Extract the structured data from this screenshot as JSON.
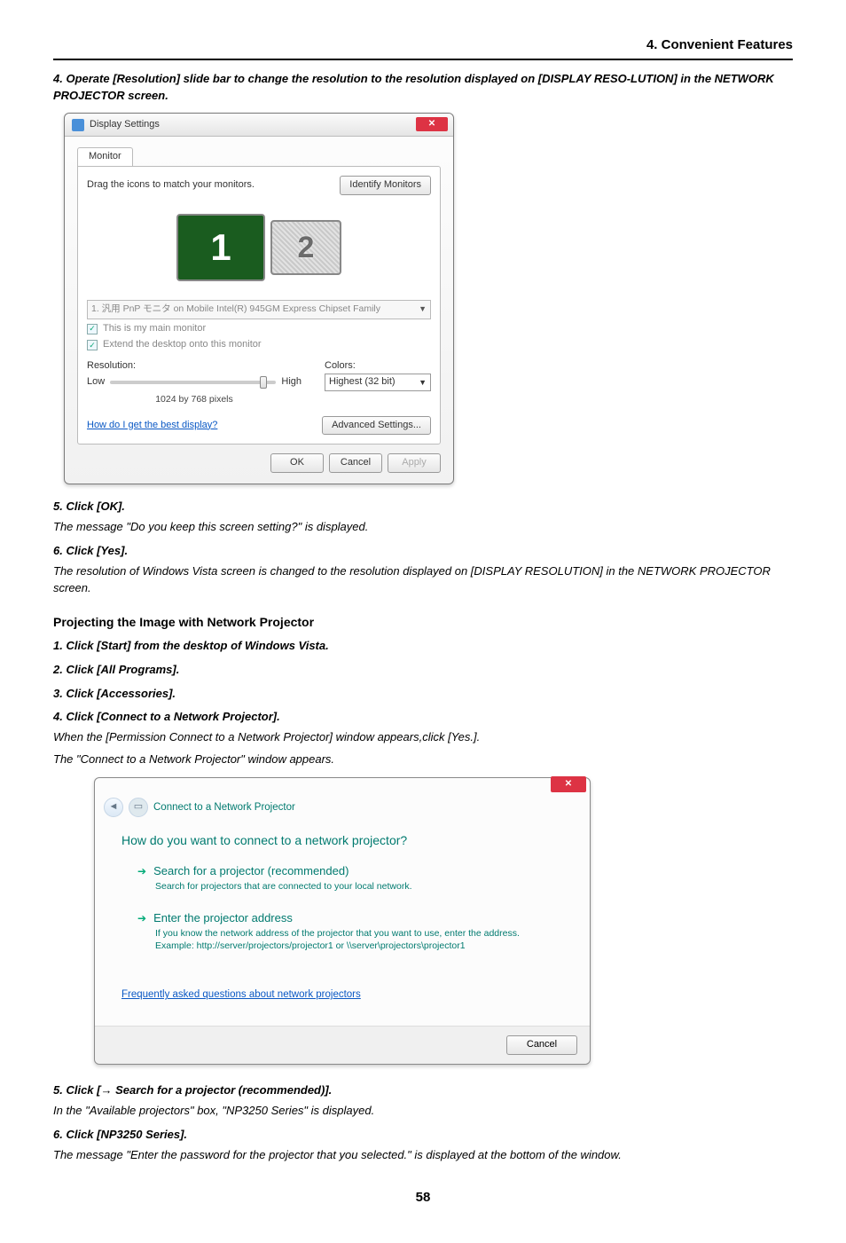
{
  "header": {
    "title": "4. Convenient Features"
  },
  "steps_upper": [
    {
      "num": "4.",
      "text": "Operate [Resolution] slide bar to change the resolution to the resolution displayed on [DISPLAY RESO-LUTION] in the NETWORK PROJECTOR screen."
    }
  ],
  "dlg1": {
    "title": "Display Settings",
    "tab": "Monitor",
    "drag": "Drag the icons to match your monitors.",
    "identify": "Identify Monitors",
    "mon1": "1",
    "mon2": "2",
    "combo": "1. 汎用 PnP モニタ on Mobile Intel(R) 945GM Express Chipset Family",
    "chk1": "This is my main monitor",
    "chk2": "Extend the desktop onto this monitor",
    "res_label": "Resolution:",
    "low": "Low",
    "high": "High",
    "res_val": "1024 by 768 pixels",
    "colors_label": "Colors:",
    "colors_val": "Highest (32 bit)",
    "best": "How do I get the best display?",
    "adv": "Advanced Settings...",
    "ok": "OK",
    "cancel": "Cancel",
    "apply": "Apply"
  },
  "steps_mid": [
    {
      "num": "5.",
      "bold": "Click [OK].",
      "body": "The message \"Do you keep this screen setting?\" is displayed."
    },
    {
      "num": "6.",
      "bold": "Click [Yes].",
      "body": "The resolution of Windows Vista screen is changed to the resolution displayed on [DISPLAY RESOLUTION] in the NETWORK PROJECTOR screen."
    }
  ],
  "subhead": "Projecting the Image with Network Projector",
  "steps_proj": [
    {
      "num": "1.",
      "bold": "Click [Start] from the desktop of Windows Vista."
    },
    {
      "num": "2.",
      "bold": "Click [All Programs]."
    },
    {
      "num": "3.",
      "bold": "Click [Accessories]."
    },
    {
      "num": "4.",
      "bold": "Click [Connect to a Network Projector].",
      "body1": "When the [Permission Connect to a Network Projector] window appears,click [Yes.].",
      "body2": "The \"Connect to a Network Projector\" window appears."
    }
  ],
  "dlg2": {
    "crumb": "Connect to a Network Projector",
    "q": "How do you want to connect to a network projector?",
    "opt1_title": "Search for a projector (recommended)",
    "opt1_desc": "Search for projectors that are connected to your local network.",
    "opt2_title": "Enter the projector address",
    "opt2_desc1": "If you know the network address of the projector that you want to use, enter the address.",
    "opt2_desc2": "Example: http://server/projectors/projector1 or \\\\server\\projectors\\projector1",
    "faq": "Frequently asked questions about network projectors",
    "cancel": "Cancel"
  },
  "steps_lower": [
    {
      "num": "5.",
      "bold": "Click [→ Search for a projector (recommended)].",
      "body": "In the \"Available projectors\" box, \"NP3250 Series\" is displayed."
    },
    {
      "num": "6.",
      "bold": "Click [NP3250 Series].",
      "body": "The message \"Enter the password for the projector that you selected.\" is displayed at the bottom of the window."
    }
  ],
  "page": "58"
}
